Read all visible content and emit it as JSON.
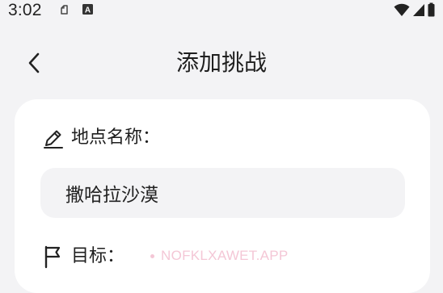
{
  "status_bar": {
    "time": "3:02",
    "icons": [
      "notification-icon",
      "keyboard-a-icon",
      "wifi-icon",
      "cellular-icon",
      "battery-icon"
    ]
  },
  "header": {
    "title": "添加挑战",
    "back_icon": "chevron-left-icon"
  },
  "form": {
    "location": {
      "label": "地点名称：",
      "icon": "pencil-icon",
      "value": "撒哈拉沙漠"
    },
    "target": {
      "label": "目标：",
      "icon": "flag-icon"
    }
  },
  "watermark": {
    "text": "NOFKLXAWET.APP"
  },
  "colors": {
    "background": "#f3f3f5",
    "card": "#ffffff",
    "input": "#f3f3f5",
    "text": "#1f1f1f",
    "watermark": "#f4c7d6"
  }
}
